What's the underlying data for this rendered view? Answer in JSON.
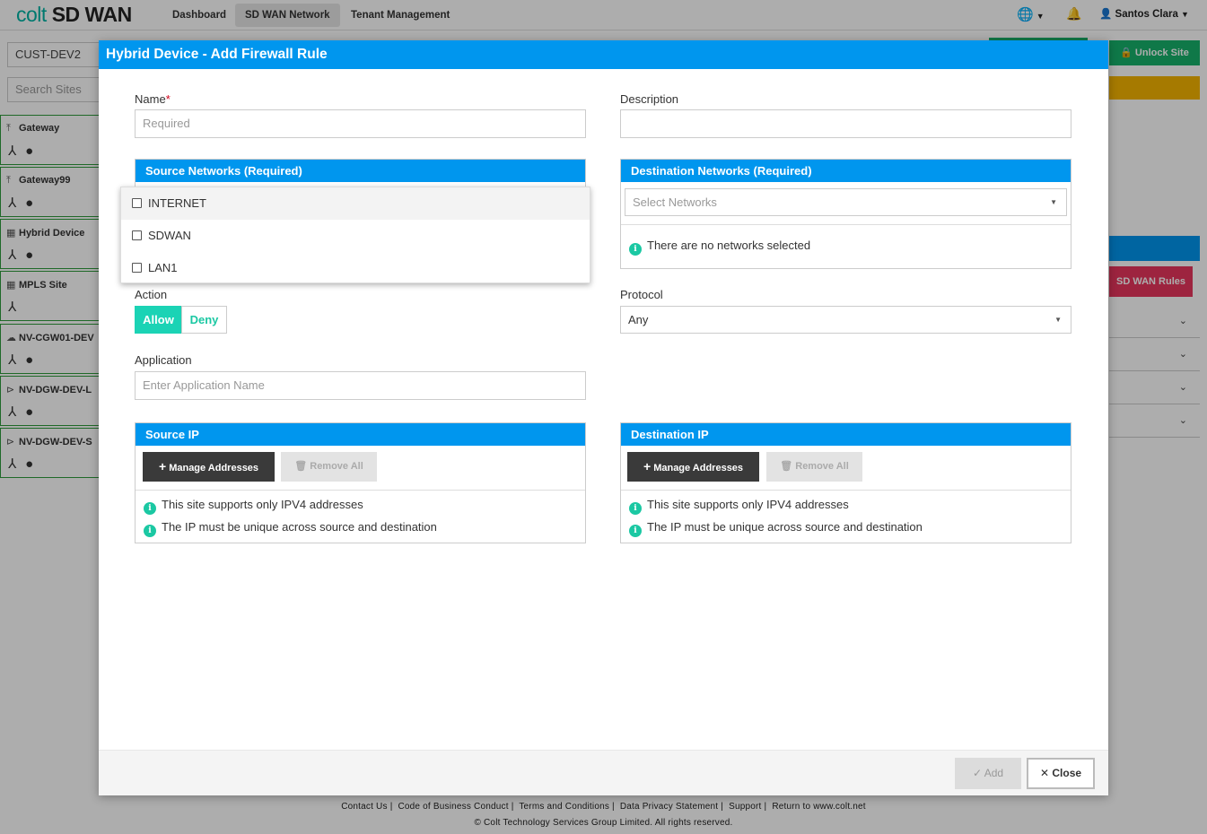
{
  "app": {
    "logo_brand": "colt",
    "logo_product": "SD WAN",
    "nav": [
      "Dashboard",
      "SD WAN Network",
      "Tenant Management"
    ],
    "user_name": "Santos Clara",
    "unlock_site_label": "Unlock Site",
    "sdwan_rules_label": "SD WAN Rules"
  },
  "sidebar": {
    "customer": "CUST-DEV2",
    "search_placeholder": "Search Sites",
    "sites": [
      {
        "name": "Gateway",
        "icon": "gateway-icon"
      },
      {
        "name": "Gateway99",
        "icon": "gateway-icon"
      },
      {
        "name": "Hybrid Device",
        "icon": "building-icon"
      },
      {
        "name": "MPLS Site",
        "icon": "building-icon"
      },
      {
        "name": "NV-CGW01-DEV",
        "icon": "cloud-icon"
      },
      {
        "name": "NV-DGW-DEV-L",
        "icon": "router-icon"
      },
      {
        "name": "NV-DGW-DEV-S",
        "icon": "router-icon"
      }
    ]
  },
  "modal": {
    "title": "Hybrid Device - Add Firewall Rule",
    "name_label": "Name",
    "name_required_marker": "*",
    "name_placeholder": "Required",
    "description_label": "Description",
    "description_value": "",
    "source_networks_title": "Source Networks (Required)",
    "source_networks_options": [
      "INTERNET",
      "SDWAN",
      "LAN1"
    ],
    "destination_networks_title": "Destination Networks (Required)",
    "destination_networks_placeholder": "Select Networks",
    "no_networks_text": "There are no networks selected",
    "action_label": "Action",
    "action_allow": "Allow",
    "action_deny": "Deny",
    "action_selected": "Allow",
    "protocol_label": "Protocol",
    "protocol_value": "Any",
    "application_label": "Application",
    "application_placeholder": "Enter Application Name",
    "source_ip_title": "Source IP",
    "destination_ip_title": "Destination IP",
    "manage_addresses_label": "Manage Addresses",
    "remove_all_label": "Remove All",
    "ipv4_note": "This site supports only IPV4 addresses",
    "unique_note": "The IP must be unique across source and destination",
    "add_label": "Add",
    "close_label": "Close"
  },
  "footer": {
    "links": [
      "Contact Us",
      "Code of Business Conduct",
      "Terms and Conditions",
      "Data Privacy Statement",
      "Support",
      "Return to www.colt.net"
    ],
    "copyright": "© Colt Technology Services Group Limited. All rights reserved."
  },
  "colors": {
    "header_blue": "#0096ee",
    "teal": "#1bd3b5",
    "site_border_green": "#2e9b3b",
    "unlock_green": "#17b26a",
    "rules_pink": "#e8365d",
    "warning_yellow": "#f5b400"
  }
}
